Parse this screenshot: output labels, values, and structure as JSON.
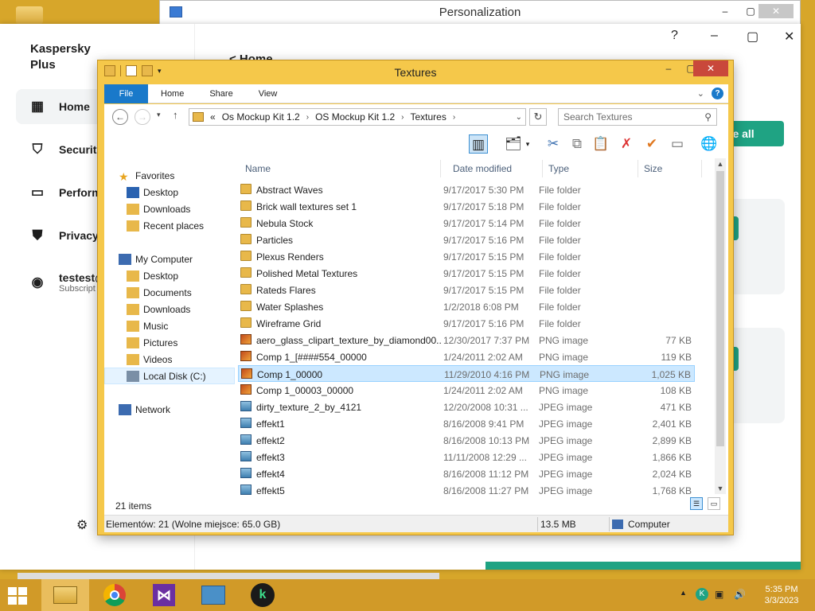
{
  "personalization": {
    "title": "Personalization",
    "controls": [
      "–",
      "▢",
      "✕"
    ]
  },
  "kaspersky": {
    "brand": "Kaspersky Plus",
    "nav": [
      {
        "label": "Home",
        "icon": "grid-icon"
      },
      {
        "label": "Security",
        "icon": "shield-icon"
      },
      {
        "label": "Perform",
        "icon": "monitor-icon"
      },
      {
        "label": "Privacy",
        "icon": "privacy-shield-icon"
      }
    ],
    "account": {
      "name": "testest@",
      "subtitle": "Subscript"
    },
    "back_label": "< Home",
    "cta": "ate all",
    "window_controls": [
      "?",
      "–",
      "▢",
      "✕"
    ]
  },
  "explorer": {
    "title": "Textures",
    "ribbon_tabs": [
      "File",
      "Home",
      "Share",
      "View"
    ],
    "help": "?",
    "address": {
      "prefix": "«",
      "crumbs": [
        "Os Mockup Kit 1.2",
        "OS Mockup Kit 1.2",
        "Textures"
      ]
    },
    "search_placeholder": "Search Textures",
    "nav_tree": [
      {
        "label": "Favorites",
        "indent": 0,
        "icon": "star-icon"
      },
      {
        "label": "Desktop",
        "indent": 1,
        "icon": "desktop-icon"
      },
      {
        "label": "Downloads",
        "indent": 1,
        "icon": "downloads-icon"
      },
      {
        "label": "Recent places",
        "indent": 1,
        "icon": "recent-places-icon"
      },
      {
        "label": "My Computer",
        "indent": 0,
        "icon": "computer-icon"
      },
      {
        "label": "Desktop",
        "indent": 1,
        "icon": "desktop-icon"
      },
      {
        "label": "Documents",
        "indent": 1,
        "icon": "documents-icon"
      },
      {
        "label": "Downloads",
        "indent": 1,
        "icon": "downloads-icon"
      },
      {
        "label": "Music",
        "indent": 1,
        "icon": "music-icon"
      },
      {
        "label": "Pictures",
        "indent": 1,
        "icon": "pictures-icon"
      },
      {
        "label": "Videos",
        "indent": 1,
        "icon": "videos-icon"
      },
      {
        "label": "Local Disk (C:)",
        "indent": 1,
        "icon": "disk-icon",
        "selected": true
      },
      {
        "label": "Network",
        "indent": 0,
        "icon": "network-icon"
      }
    ],
    "columns": [
      "Name",
      "Date modified",
      "Type",
      "Size"
    ],
    "files": [
      {
        "name": "Abstract Waves",
        "date": "9/17/2017 5:30 PM",
        "type": "File folder",
        "size": "",
        "kind": "folder"
      },
      {
        "name": "Brick wall textures set 1",
        "date": "9/17/2017 5:18 PM",
        "type": "File folder",
        "size": "",
        "kind": "folder"
      },
      {
        "name": "Nebula Stock",
        "date": "9/17/2017 5:14 PM",
        "type": "File folder",
        "size": "",
        "kind": "folder"
      },
      {
        "name": "Particles",
        "date": "9/17/2017 5:16 PM",
        "type": "File folder",
        "size": "",
        "kind": "folder"
      },
      {
        "name": "Plexus Renders",
        "date": "9/17/2017 5:15 PM",
        "type": "File folder",
        "size": "",
        "kind": "folder"
      },
      {
        "name": "Polished Metal Textures",
        "date": "9/17/2017 5:15 PM",
        "type": "File folder",
        "size": "",
        "kind": "folder"
      },
      {
        "name": "Rateds Flares",
        "date": "9/17/2017 5:15 PM",
        "type": "File folder",
        "size": "",
        "kind": "folder"
      },
      {
        "name": "Water Splashes",
        "date": "1/2/2018 6:08 PM",
        "type": "File folder",
        "size": "",
        "kind": "folder"
      },
      {
        "name": "Wireframe Grid",
        "date": "9/17/2017 5:16 PM",
        "type": "File folder",
        "size": "",
        "kind": "folder"
      },
      {
        "name": "aero_glass_clipart_texture_by_diamond00...",
        "date": "12/30/2017 7:37 PM",
        "type": "PNG image",
        "size": "77 KB",
        "kind": "png"
      },
      {
        "name": "Comp 1_[####554_00000",
        "date": "1/24/2011 2:02 AM",
        "type": "PNG image",
        "size": "119 KB",
        "kind": "png"
      },
      {
        "name": "Comp 1_00000",
        "date": "11/29/2010 4:16 PM",
        "type": "PNG image",
        "size": "1,025 KB",
        "kind": "png",
        "selected": true
      },
      {
        "name": "Comp 1_00003_00000",
        "date": "1/24/2011 2:02 AM",
        "type": "PNG image",
        "size": "108 KB",
        "kind": "png"
      },
      {
        "name": "dirty_texture_2_by_4121",
        "date": "12/20/2008 10:31 ...",
        "type": "JPEG image",
        "size": "471 KB",
        "kind": "jpeg"
      },
      {
        "name": "effekt1",
        "date": "8/16/2008 9:41 PM",
        "type": "JPEG image",
        "size": "2,401 KB",
        "kind": "jpeg"
      },
      {
        "name": "effekt2",
        "date": "8/16/2008 10:13 PM",
        "type": "JPEG image",
        "size": "2,899 KB",
        "kind": "jpeg"
      },
      {
        "name": "effekt3",
        "date": "11/11/2008 12:29 ...",
        "type": "JPEG image",
        "size": "1,866 KB",
        "kind": "jpeg"
      },
      {
        "name": "effekt4",
        "date": "8/16/2008 11:12 PM",
        "type": "JPEG image",
        "size": "2,024 KB",
        "kind": "jpeg"
      },
      {
        "name": "effekt5",
        "date": "8/16/2008 11:27 PM",
        "type": "JPEG image",
        "size": "1,768 KB",
        "kind": "jpeg"
      }
    ],
    "item_count": "21 items",
    "status": {
      "left": "Elementów: 21 (Wolne miejsce: 65.0 GB)",
      "size": "13.5 MB",
      "location": "Computer"
    }
  },
  "taskbar": {
    "apps": [
      "file-explorer-icon",
      "chrome-icon",
      "visual-studio-icon",
      "control-panel-icon",
      "kaspersky-icon"
    ],
    "time": "5:35 PM",
    "date": "3/3/2023"
  }
}
